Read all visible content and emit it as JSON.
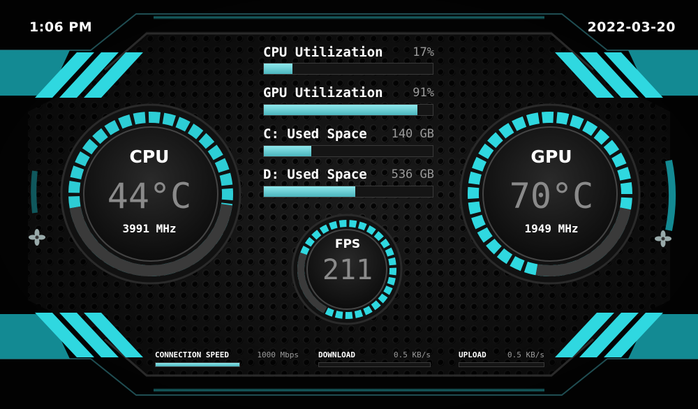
{
  "header": {
    "time": "1:06 PM",
    "date": "2022-03-20"
  },
  "colors": {
    "accent": "#2fd8e0",
    "dark_accent": "#138a93",
    "bar_fill": "#6ccfd6"
  },
  "bars": [
    {
      "label": "CPU Utilization",
      "value": "17%",
      "fill_pct": 17
    },
    {
      "label": "GPU Utilization",
      "value": "91%",
      "fill_pct": 91
    },
    {
      "label": "C: Used Space",
      "value": "140 GB",
      "fill_pct": 28
    },
    {
      "label": "D: Used Space",
      "value": "536 GB",
      "fill_pct": 54
    }
  ],
  "cpu": {
    "title": "CPU",
    "temp": "44°C",
    "clock": "3991 MHz"
  },
  "gpu": {
    "title": "GPU",
    "temp": "70°C",
    "clock": "1949 MHz"
  },
  "fps": {
    "title": "FPS",
    "value": "211"
  },
  "network": [
    {
      "label": "CONNECTION SPEED",
      "value": "1000 Mbps",
      "fill_pct": 100
    },
    {
      "label": "DOWNLOAD",
      "value": "0.5 KB/s",
      "fill_pct": 0
    },
    {
      "label": "UPLOAD",
      "value": "0.5 KB/s",
      "fill_pct": 0
    }
  ],
  "icons": {
    "fan_left": "fan-icon",
    "fan_right": "fan-icon"
  }
}
